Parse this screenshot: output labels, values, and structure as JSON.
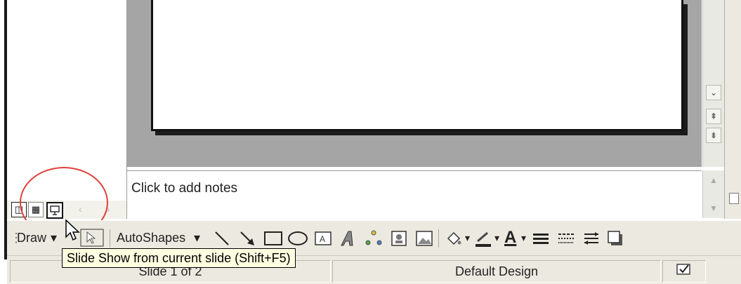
{
  "notes": {
    "placeholder": "Click to add notes"
  },
  "views": [
    {
      "name": "normal-view-icon"
    },
    {
      "name": "slide-sorter-view-icon"
    },
    {
      "name": "slide-show-view-icon"
    }
  ],
  "drawing_toolbar": {
    "draw_label": "Draw",
    "autoshapes_label": "AutoShapes",
    "dropdown_glyph": "▾",
    "font_color_glyph": "A"
  },
  "tooltip": {
    "text": "Slide Show from current slide (Shift+F5)"
  },
  "status": {
    "slide_counter": "Slide 1 of 2",
    "design_name": "Default Design"
  },
  "colors": {
    "highlight_circle": "#e0403a",
    "tooltip_bg": "#ffffe1",
    "accent_red": "#d21f1f",
    "accent_blue": "#1f3fbf"
  }
}
